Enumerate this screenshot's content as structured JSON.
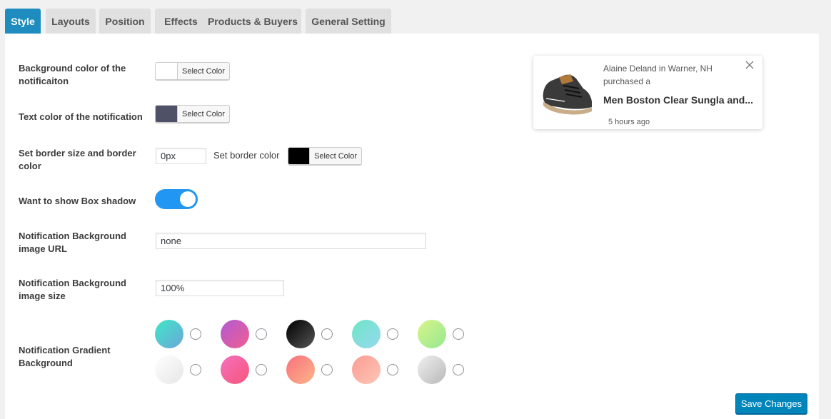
{
  "tabs": [
    {
      "label": "Style",
      "active": true
    },
    {
      "label": "Layouts",
      "active": false
    },
    {
      "label": "Position",
      "active": false
    },
    {
      "label": "Effects",
      "active": false
    },
    {
      "label": "Products & Buyers",
      "active": false
    },
    {
      "label": "General Setting",
      "active": false
    }
  ],
  "fields": {
    "bg_color": {
      "label": "Background color of the notificaiton",
      "button": "Select Color",
      "color": "#ffffff"
    },
    "text_color": {
      "label": "Text color of the notification",
      "button": "Select Color",
      "color": "#4f5266"
    },
    "border": {
      "label": "Set border size and border color",
      "size_value": "0px",
      "color_label": "Set border color",
      "button": "Select Color",
      "color": "#000000"
    },
    "box_shadow": {
      "label": "Want to show Box shadow",
      "enabled": true
    },
    "bg_image_url": {
      "label": "Notification Background image URL",
      "value": "none"
    },
    "bg_image_size": {
      "label": "Notification Background image size",
      "value": "100%"
    },
    "gradient": {
      "label": "Notification Gradient Background",
      "options": [
        {
          "from": "#3ee8c8",
          "to": "#6ca6d8"
        },
        {
          "from": "#b05ad6",
          "to": "#f15e8e"
        },
        {
          "from": "#000000",
          "to": "#555555"
        },
        {
          "from": "#6ee6c6",
          "to": "#96d8ee"
        },
        {
          "from": "#d8f48a",
          "to": "#96e890"
        },
        {
          "from": "#ffffff",
          "to": "#e6e6e6"
        },
        {
          "from": "#f56fbf",
          "to": "#f5577a"
        },
        {
          "from": "#f8707c",
          "to": "#fdb58a"
        },
        {
          "from": "#fc9b94",
          "to": "#fcc7b5"
        },
        {
          "from": "#f0f0f0",
          "to": "#b8b8b8"
        }
      ]
    }
  },
  "preview": {
    "who": "Alaine Deland in Warner, NH purchased a",
    "product": "Men Boston Clear Sungla and...",
    "time": "5 hours ago"
  },
  "save_label": "Save Changes",
  "colors": {
    "accent": "#1e8cbe",
    "toggle": "#2196f3",
    "save": "#0085ba"
  }
}
